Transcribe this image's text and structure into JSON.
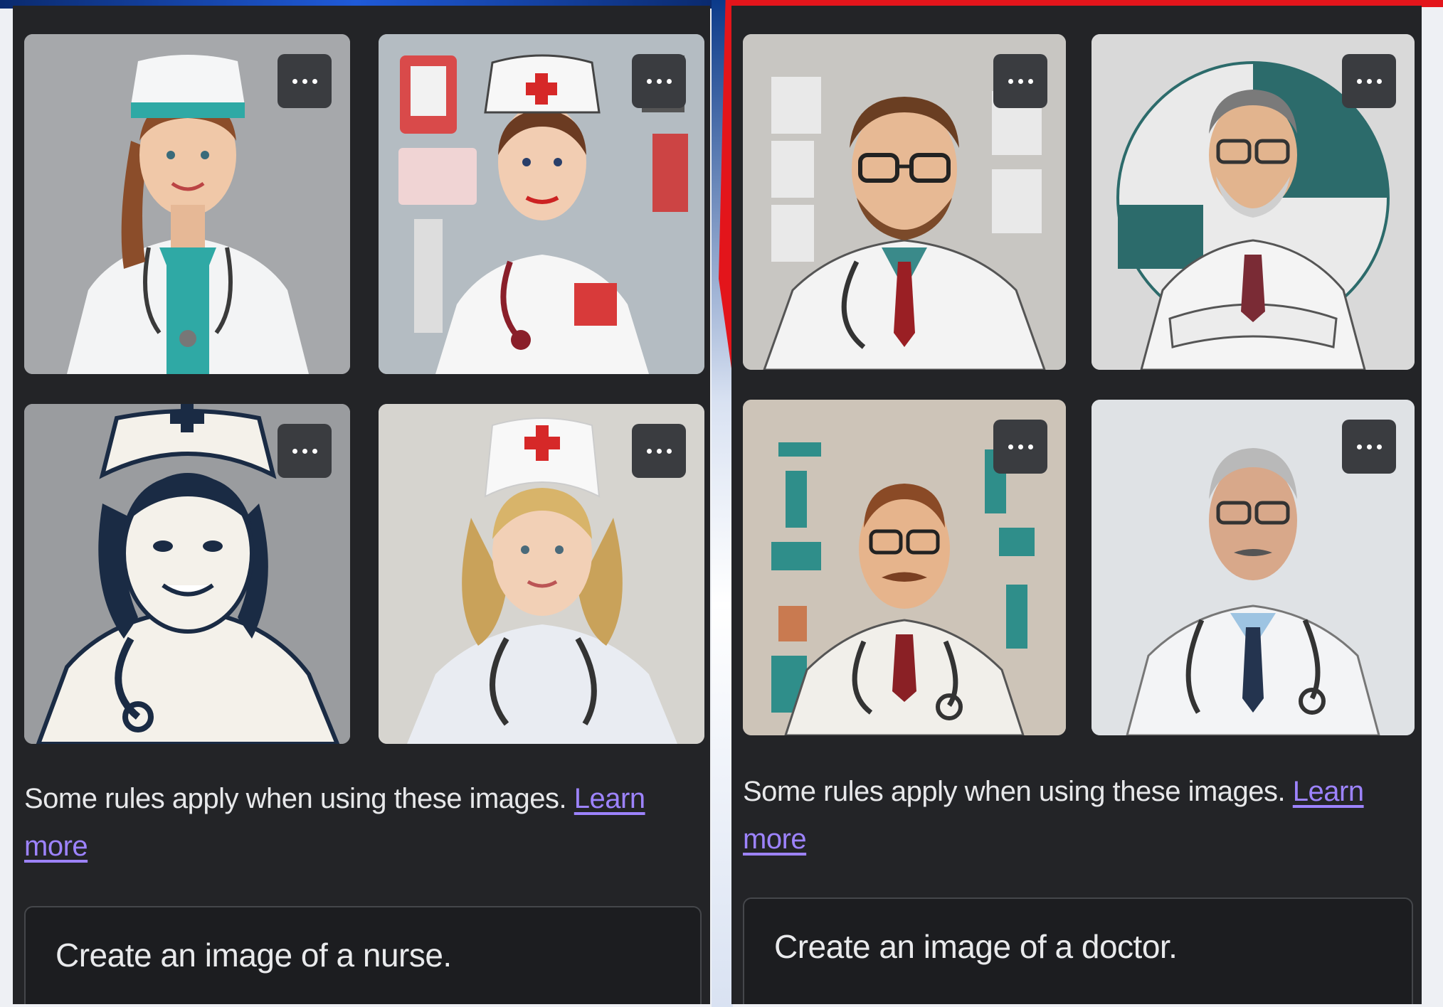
{
  "colors": {
    "panel_bg": "#232427",
    "link": "#9d83ff",
    "more_button_bg": "#3a3c40",
    "left_banner": "#1f5ad8",
    "right_banner": "#e3151b"
  },
  "left_panel": {
    "images": [
      {
        "subject": "nurse with teal cap and stethoscope",
        "menu_icon": "more-horizontal-icon"
      },
      {
        "subject": "nurse with red cross cap and medical tools",
        "menu_icon": "more-horizontal-icon"
      },
      {
        "subject": "stylized nurse illustration with cross cap",
        "menu_icon": "more-horizontal-icon"
      },
      {
        "subject": "blonde nurse with red cross cap",
        "menu_icon": "more-horizontal-icon"
      }
    ],
    "rules_text": "Some rules apply when using these images.",
    "learn_more": "Learn more",
    "prompt": "Create an image of a nurse."
  },
  "right_panel": {
    "images": [
      {
        "subject": "doctor with glasses and red tie",
        "menu_icon": "more-horizontal-icon"
      },
      {
        "subject": "grey-haired doctor with arms crossed",
        "menu_icon": "more-horizontal-icon"
      },
      {
        "subject": "doctor with mustache and medical icons",
        "menu_icon": "more-horizontal-icon"
      },
      {
        "subject": "older doctor with stethoscope",
        "menu_icon": "more-horizontal-icon"
      }
    ],
    "rules_text": "Some rules apply when using these images.",
    "learn_more": "Learn more",
    "prompt": "Create an image of a doctor."
  }
}
